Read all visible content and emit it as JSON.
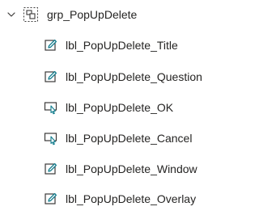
{
  "tree": {
    "group": {
      "label": "grp_PopUpDelete",
      "expanded": true,
      "icon": "group-icon",
      "chevron_icon": "chevron-down-icon"
    },
    "children": [
      {
        "label": "lbl_PopUpDelete_Title",
        "icon": "edit-icon"
      },
      {
        "label": "lbl_PopUpDelete_Question",
        "icon": "edit-icon"
      },
      {
        "label": "lbl_PopUpDelete_OK",
        "icon": "button-icon"
      },
      {
        "label": "lbl_PopUpDelete_Cancel",
        "icon": "button-icon"
      },
      {
        "label": "lbl_PopUpDelete_Window",
        "icon": "edit-icon"
      },
      {
        "label": "lbl_PopUpDelete_Overlay",
        "icon": "edit-icon"
      }
    ],
    "colors": {
      "text": "#252423",
      "icon_dark": "#3b3a39",
      "icon_accent": "#0f7b8c"
    }
  }
}
